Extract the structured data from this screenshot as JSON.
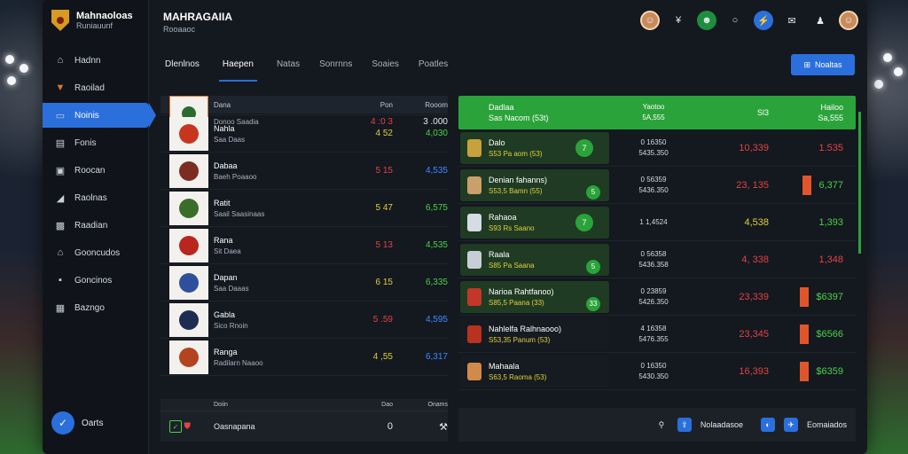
{
  "brand": {
    "name": "Mahnaoloas",
    "sub": "Runiauunf"
  },
  "header": {
    "title": "MAHRAGAIIA",
    "subtitle": "Rooaaoc"
  },
  "sidebar": {
    "items": [
      {
        "label": "Hadnn",
        "icon": "home-icon"
      },
      {
        "label": "Raoilad",
        "icon": "shield-icon"
      },
      {
        "label": "Noinis",
        "icon": "folder-icon"
      },
      {
        "label": "Fonis",
        "icon": "chart-icon"
      },
      {
        "label": "Roocan",
        "icon": "lock-icon"
      },
      {
        "label": "Raolnas",
        "icon": "whistle-icon"
      },
      {
        "label": "Raadian",
        "icon": "camera-icon"
      },
      {
        "label": "Gooncudos",
        "icon": "home-icon"
      },
      {
        "label": "Goncinos",
        "icon": "box-icon"
      },
      {
        "label": "Bazngo",
        "icon": "image-icon"
      }
    ],
    "active_index": 2,
    "user": "Oarts"
  },
  "tabs": [
    "Dlenlnos",
    "Haepen",
    "Natas",
    "Sonrnns",
    "Soaies",
    "Poatles"
  ],
  "active_tab": 1,
  "add_button": "Noaltas",
  "left_table": {
    "headers": [
      "",
      "Dana",
      "Pon",
      "Rooom"
    ],
    "first_row": {
      "name": "Donoo Saadia",
      "v1": "4 :0 3",
      "v2": "3 .000"
    },
    "rows": [
      {
        "name": "Nahla",
        "sub": "Saa Daas",
        "v1": "4 52",
        "v2": "4,030",
        "crest": "#c8351f",
        "v1color": "y",
        "v2color": "g"
      },
      {
        "name": "Dabaa",
        "sub": "Baeh Poaaoo",
        "v1": "5 15",
        "v2": "4,535",
        "crest": "#7b2d22",
        "v1color": "r",
        "v2color": "b"
      },
      {
        "name": "Ratit",
        "sub": "Saail Saasinaas",
        "v1": "5 47",
        "v2": "6,575",
        "crest": "#3b6d2a",
        "v1color": "y",
        "v2color": "g"
      },
      {
        "name": "Rana",
        "sub": "Sit Daea",
        "v1": "5 13",
        "v2": "4,535",
        "crest": "#b8261d",
        "v1color": "r",
        "v2color": "g"
      },
      {
        "name": "Dapan",
        "sub": "Saa Daaas",
        "v1": "6 15",
        "v2": "6,335",
        "crest": "#2e4f9c",
        "v1color": "y",
        "v2color": "g"
      },
      {
        "name": "Gabla",
        "sub": "Sico Rnoin",
        "v1": "5 .59",
        "v2": "4,595",
        "crest": "#1f2c52",
        "v1color": "r",
        "v2color": "b"
      },
      {
        "name": "Ranga",
        "sub": "Radilarn Naaoo",
        "v1": "4 ,55",
        "v2": "6,317",
        "crest": "#b3441f",
        "v1color": "y",
        "v2color": "b"
      }
    ],
    "footer": {
      "headers": [
        "",
        "Doiin",
        "Dao",
        "Onams"
      ],
      "name": "Oasnapana",
      "v1": "0",
      "v2": "⚒"
    }
  },
  "right_table": {
    "header": {
      "name": "Dadlaa",
      "sub": "Sas Nacom (53t)",
      "stat": "Yaotoo",
      "stat_sub": "5A,555",
      "v1": "Sl3",
      "v2": "Hailoo",
      "v2_sub": "Sa,555"
    },
    "rows": [
      {
        "name": "Dalo",
        "sub": "S53 Pa aom (53)",
        "badge": "7",
        "stat1": "0 16350",
        "stat2": "5435.350",
        "v1": "10,339",
        "v1color": "red",
        "v2": "1.535",
        "v2color": "red",
        "bar": false,
        "card": "green",
        "figure": "#c7a23c"
      },
      {
        "name": "Denian fahanns)",
        "sub": "S53,5 Bamn (55)",
        "badge": "5",
        "stat1": "0 56359",
        "stat2": "5436.350",
        "v1": "23, 135",
        "v1color": "red",
        "v2": "6,377",
        "v2color": "green",
        "bar": true,
        "card": "green",
        "figure": "#caa06a"
      },
      {
        "name": "Rahaoa",
        "sub": "S93 Rs Saano",
        "badge": "7",
        "stat1": "1 1,4524",
        "stat2": "",
        "v1": "4,538",
        "v1color": "yellow",
        "v2": "1,393",
        "v2color": "green",
        "bar": false,
        "card": "green",
        "figure": "#d6dbe4"
      },
      {
        "name": "Raala",
        "sub": "S85 Pa Saana",
        "badge": "5",
        "stat1": "0 56358",
        "stat2": "5436.358",
        "v1": "4, 338",
        "v1color": "red",
        "v2": "1,348",
        "v2color": "red",
        "bar": false,
        "card": "green",
        "figure": "#c9ced6"
      },
      {
        "name": "Narioa Rahtfanoo)",
        "sub": "S85,5 Paana (33)",
        "badge": "33",
        "stat1": "0 23859",
        "stat2": "5426.350",
        "v1": "23,339",
        "v1color": "red",
        "v2": "$6397",
        "v2color": "green",
        "bar": true,
        "card": "green",
        "figure": "#c5362a"
      },
      {
        "name": "Nahlelfa Ralhnaooo)",
        "sub": "S53,35 Panum (53)",
        "badge": "",
        "stat1": "4 16358",
        "stat2": "5476.355",
        "v1": "23,345",
        "v1color": "red",
        "v2": "$6566",
        "v2color": "green",
        "bar": true,
        "card": "dark",
        "figure": "#b8321f"
      },
      {
        "name": "Mahaala",
        "sub": "S63,5 Raoma (53)",
        "badge": "",
        "stat1": "0 16350",
        "stat2": "5430.350",
        "v1": "16,393",
        "v1color": "red",
        "v2": "$6359",
        "v2color": "green",
        "bar": true,
        "card": "dark",
        "figure": "#d08a4a"
      }
    ],
    "footer": {
      "link1": "Nolaadasoe",
      "link2": "Eomaiados"
    }
  },
  "colors": {
    "accent": "#2a6fdc",
    "green": "#2aa33a",
    "red": "#e04444",
    "yellow": "#e0d03a",
    "orange": "#e2552a"
  }
}
